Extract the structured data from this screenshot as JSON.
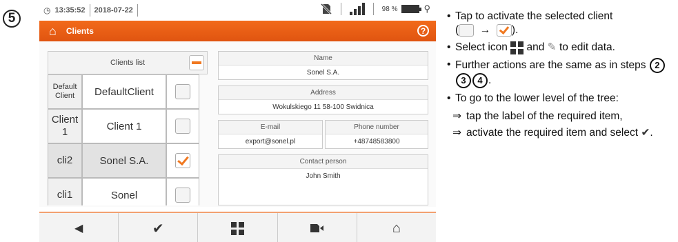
{
  "step_number": "5",
  "status": {
    "time": "13:35:52",
    "date": "2018-07-22",
    "battery": "98 %"
  },
  "title": "Clients",
  "clients_list": {
    "header": "Clients list",
    "rows": [
      {
        "id": "Default Client",
        "name": "DefaultClient",
        "checked": false,
        "selected": false
      },
      {
        "id": "Client 1",
        "name": "Client 1",
        "checked": false,
        "selected": false
      },
      {
        "id": "cli2",
        "name": "Sonel S.A.",
        "checked": true,
        "selected": true
      },
      {
        "id": "cli1",
        "name": "Sonel",
        "checked": false,
        "selected": false
      }
    ]
  },
  "details": {
    "name_label": "Name",
    "name_value": "Sonel S.A.",
    "address_label": "Address",
    "address_value": "Wokulskiego 11 58-100 Swidnica",
    "email_label": "E-mail",
    "email_value": "export@sonel.pl",
    "phone_label": "Phone number",
    "phone_value": "+48748583800",
    "contact_label": "Contact person",
    "contact_value": "John Smith"
  },
  "colors": {
    "accent": "#f07820"
  },
  "icons": [
    "back-arrow-icon",
    "checkmark-icon",
    "grid-icon",
    "memory-card-icon",
    "home-icon"
  ],
  "instructions": {
    "b1": "Tap to activate the selected client",
    "b2_pre": "Select icon",
    "b2_mid": "and",
    "b2_post": "to edit data.",
    "b3": "Further actions are the same as in steps",
    "step_a": "2",
    "step_b": "3",
    "step_c": "4",
    "b4": "To go to the lower level of the tree:",
    "s1": "tap the label of the required item,",
    "s2": "activate the required item and select"
  }
}
